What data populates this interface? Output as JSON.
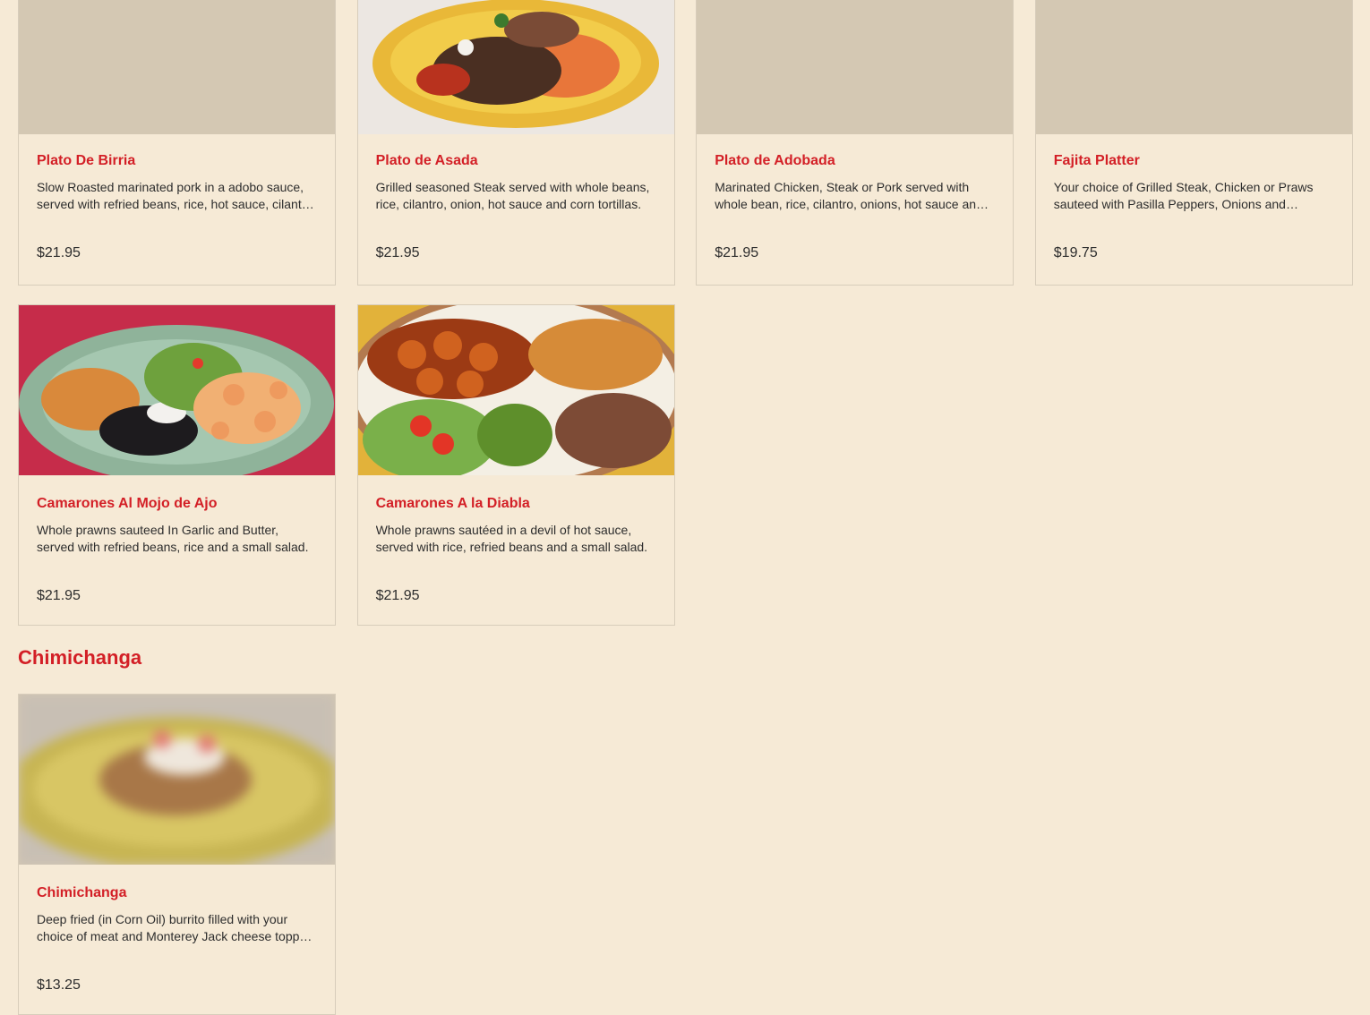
{
  "items_row1": [
    {
      "title": "Plato De Birria",
      "desc": "Slow Roasted marinated pork in a adobo sauce, served with refried beans, rice, hot sauce, cilantro, onion and corn tortillas.",
      "price": "$21.95",
      "image": "placeholder"
    },
    {
      "title": "Plato de Asada",
      "desc": "Grilled seasoned Steak served with whole beans, rice, cilantro, onion, hot sauce and corn tortillas.",
      "price": "$21.95",
      "image": "asada-plate"
    },
    {
      "title": "Plato de Adobada",
      "desc": "Marinated Chicken, Steak or Pork served with whole bean, rice, cilantro, onions, hot sauce and corn tortillas.",
      "price": "$21.95",
      "image": "placeholder"
    },
    {
      "title": "Fajita Platter",
      "desc": "Your choice of Grilled Steak, Chicken or Praws sauteed with Pasilla Peppers, Onions and Tomatoes.",
      "price": "$19.75",
      "image": "placeholder"
    }
  ],
  "items_row2": [
    {
      "title": "Camarones Al Mojo de Ajo",
      "desc": "Whole prawns sauteed In Garlic and Butter, served with refried beans, rice and a small salad.",
      "price": "$21.95",
      "image": "mojo-plate"
    },
    {
      "title": "Camarones A la Diabla",
      "desc": "Whole prawns sautéed in a devil of hot sauce, served with rice, refried beans and a small salad.",
      "price": "$21.95",
      "image": "diabla-plate"
    }
  ],
  "section": {
    "title": "Chimichanga"
  },
  "items_row3": [
    {
      "title": "Chimichanga",
      "desc": "Deep fried (in Corn Oil) burrito filled with your choice of meat and Monterey Jack cheese topped with sour cream.",
      "price": "$13.25",
      "image": "chimichanga-plate"
    }
  ],
  "colors": {
    "accent": "#d31f26",
    "background": "#f6ead6",
    "placeholder": "#d4c8b3",
    "border": "#d8cdbb"
  }
}
